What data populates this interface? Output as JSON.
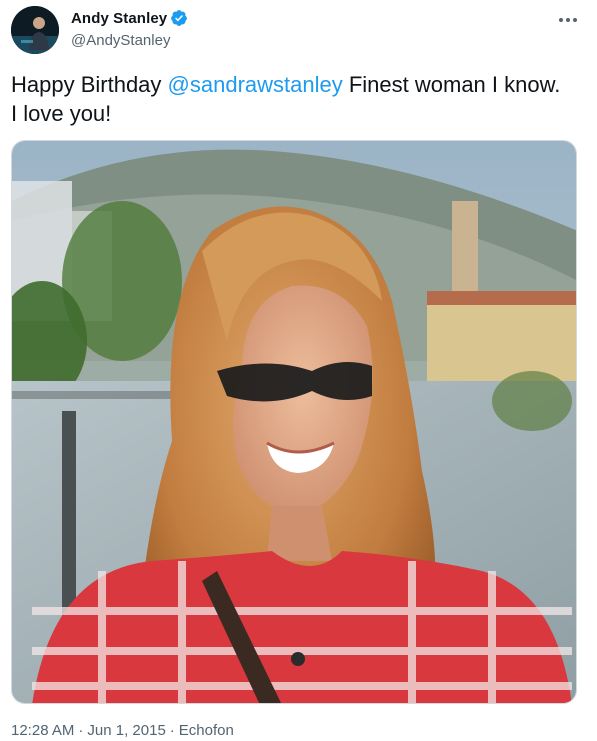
{
  "author": {
    "display_name": "Andy Stanley",
    "handle": "@AndyStanley",
    "verified": true,
    "avatar_icon": "profile-avatar-icon"
  },
  "tweet": {
    "text_before": "Happy Birthday ",
    "mention": "@sandrawstanley",
    "text_after": " Finest woman I know. I love you!",
    "image_alt": "photo"
  },
  "meta": {
    "time": "12:28 AM",
    "separator1": " · ",
    "date": "Jun 1, 2015",
    "separator2": " · ",
    "source": "Echofon"
  },
  "colors": {
    "link": "#1d9bf0",
    "secondary_text": "#536471",
    "primary_text": "#0f1419"
  },
  "icons": {
    "more": "more-icon",
    "verified": "verified-badge-icon"
  }
}
